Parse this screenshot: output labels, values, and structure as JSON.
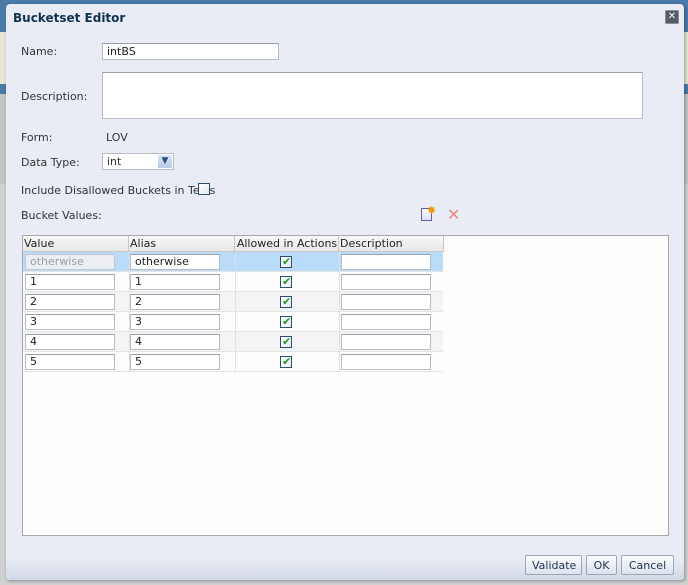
{
  "dialog": {
    "title": "Bucketset Editor",
    "close_icon": "close-icon"
  },
  "form": {
    "name_label": "Name:",
    "name_value": "intBS",
    "description_label": "Description:",
    "description_value": "",
    "form_label": "Form:",
    "form_value": "LOV",
    "data_type_label": "Data Type:",
    "data_type_value": "int",
    "include_disallowed_label": "Include Disallowed Buckets in Tests",
    "include_disallowed_checked": false,
    "bucket_values_label": "Bucket Values:"
  },
  "toolbar": {
    "add_icon": "new-bucket-icon",
    "delete_icon": "delete-bucket-icon"
  },
  "table": {
    "columns": [
      "Value",
      "Alias",
      "Allowed in Actions",
      "Description"
    ],
    "rows": [
      {
        "value": "otherwise",
        "alias": "otherwise",
        "allowed": true,
        "description": "",
        "value_disabled": true,
        "selected": true
      },
      {
        "value": "1",
        "alias": "1",
        "allowed": true,
        "description": ""
      },
      {
        "value": "2",
        "alias": "2",
        "allowed": true,
        "description": ""
      },
      {
        "value": "3",
        "alias": "3",
        "allowed": true,
        "description": ""
      },
      {
        "value": "4",
        "alias": "4",
        "allowed": true,
        "description": ""
      },
      {
        "value": "5",
        "alias": "5",
        "allowed": true,
        "description": ""
      }
    ]
  },
  "buttons": {
    "validate": "Validate",
    "ok": "OK",
    "cancel": "Cancel"
  }
}
